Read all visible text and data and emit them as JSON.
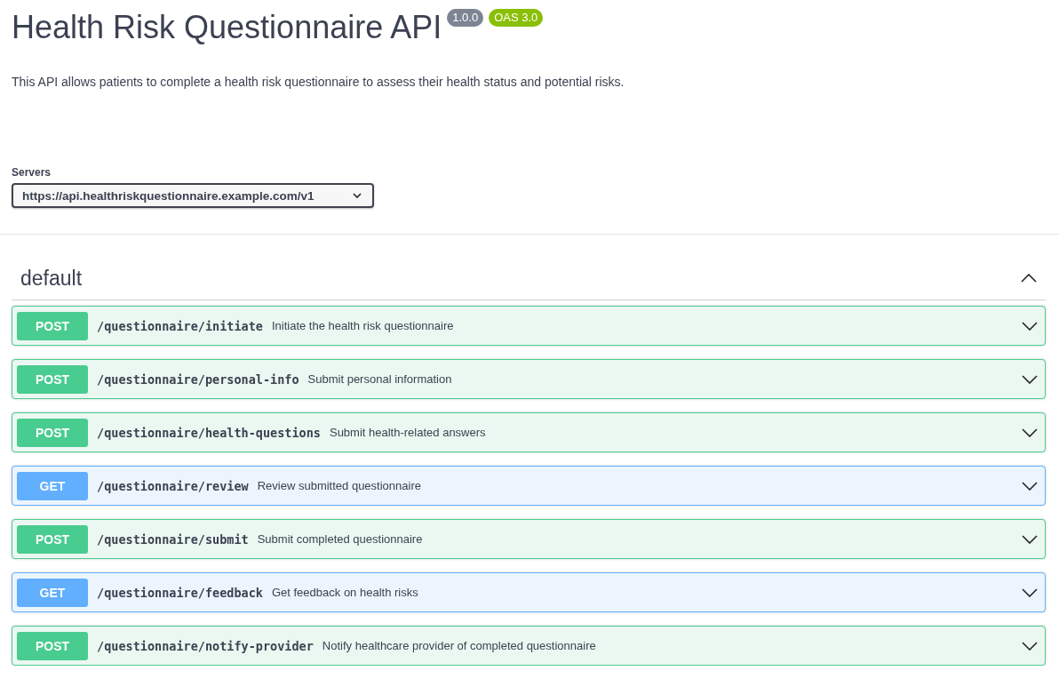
{
  "info": {
    "title": "Health Risk Questionnaire API",
    "version": "1.0.0",
    "oas": "OAS 3.0",
    "description": "This API allows patients to complete a health risk questionnaire to assess their health status and potential risks."
  },
  "servers": {
    "label": "Servers",
    "value": "https://api.healthriskquestionnaire.example.com/v1"
  },
  "section": {
    "name": "default",
    "expanded": true,
    "operations": [
      {
        "kind": "post",
        "method": "POST",
        "path": "/questionnaire/initiate",
        "summary": "Initiate the health risk questionnaire",
        "expanded": false
      },
      {
        "kind": "post",
        "method": "POST",
        "path": "/questionnaire/personal-info",
        "summary": "Submit personal information",
        "expanded": false
      },
      {
        "kind": "post",
        "method": "POST",
        "path": "/questionnaire/health-questions",
        "summary": "Submit health-related answers",
        "expanded": false
      },
      {
        "kind": "get",
        "method": "GET",
        "path": "/questionnaire/review",
        "summary": "Review submitted questionnaire",
        "expanded": false
      },
      {
        "kind": "post",
        "method": "POST",
        "path": "/questionnaire/submit",
        "summary": "Submit completed questionnaire",
        "expanded": false
      },
      {
        "kind": "get",
        "method": "GET",
        "path": "/questionnaire/feedback",
        "summary": "Get feedback on health risks",
        "expanded": false
      },
      {
        "kind": "post",
        "method": "POST",
        "path": "/questionnaire/notify-provider",
        "summary": "Notify healthcare provider of completed questionnaire",
        "expanded": false
      }
    ]
  }
}
